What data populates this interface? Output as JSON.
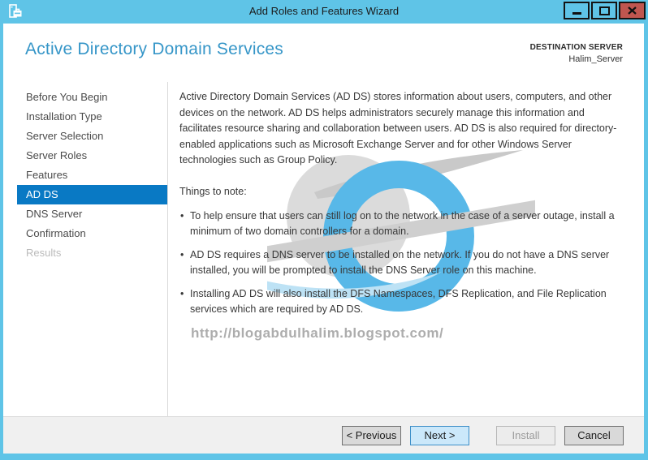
{
  "window": {
    "title": "Add Roles and Features Wizard"
  },
  "header": {
    "page_title": "Active Directory Domain Services",
    "destination_label": "DESTINATION SERVER",
    "destination_server": "Halim_Server"
  },
  "sidebar": {
    "items": [
      {
        "label": "Before You Begin",
        "state": "normal"
      },
      {
        "label": "Installation Type",
        "state": "normal"
      },
      {
        "label": "Server Selection",
        "state": "normal"
      },
      {
        "label": "Server Roles",
        "state": "normal"
      },
      {
        "label": "Features",
        "state": "normal"
      },
      {
        "label": "AD DS",
        "state": "selected"
      },
      {
        "label": "DNS Server",
        "state": "normal"
      },
      {
        "label": "Confirmation",
        "state": "normal"
      },
      {
        "label": "Results",
        "state": "disabled"
      }
    ]
  },
  "content": {
    "intro": "Active Directory Domain Services (AD DS) stores information about users, computers, and other devices on the network.  AD DS helps administrators securely manage this information and facilitates resource sharing and collaboration between users.  AD DS is also required for directory-enabled applications such as Microsoft Exchange Server and for other Windows Server technologies such as Group Policy.",
    "things_heading": "Things to note:",
    "bullets": [
      "To help ensure that users can still log on to the network in the case of a server outage, install a minimum of two domain controllers for a domain.",
      "AD DS requires a DNS server to be installed on the network.  If you do not have a DNS server installed, you will be prompted to install the DNS Server role on this machine.",
      "Installing AD DS will also install the DFS Namespaces, DFS Replication, and File Replication services which are required by AD DS."
    ],
    "watermark_url": "http://blogabdulhalim.blogspot.com/"
  },
  "footer": {
    "buttons": [
      {
        "label": "< Previous",
        "state": "normal"
      },
      {
        "label": "Next >",
        "state": "default"
      },
      {
        "label": "Install",
        "state": "disabled"
      },
      {
        "label": "Cancel",
        "state": "normal"
      }
    ]
  },
  "icons": {
    "titlebar_icon": "roles-wizard-icon",
    "minimize": "minimize-icon",
    "maximize": "maximize-icon",
    "close": "close-icon"
  },
  "colors": {
    "titlebar": "#5FC4E7",
    "selected_nav": "#0979C4",
    "header_title": "#3696C8",
    "close_button": "#C0564F",
    "next_button_bg": "#CBE8FA",
    "next_button_border": "#3E8FC8",
    "watermark_blue": "#58B8E8",
    "watermark_gray": "#CFCFCF"
  }
}
